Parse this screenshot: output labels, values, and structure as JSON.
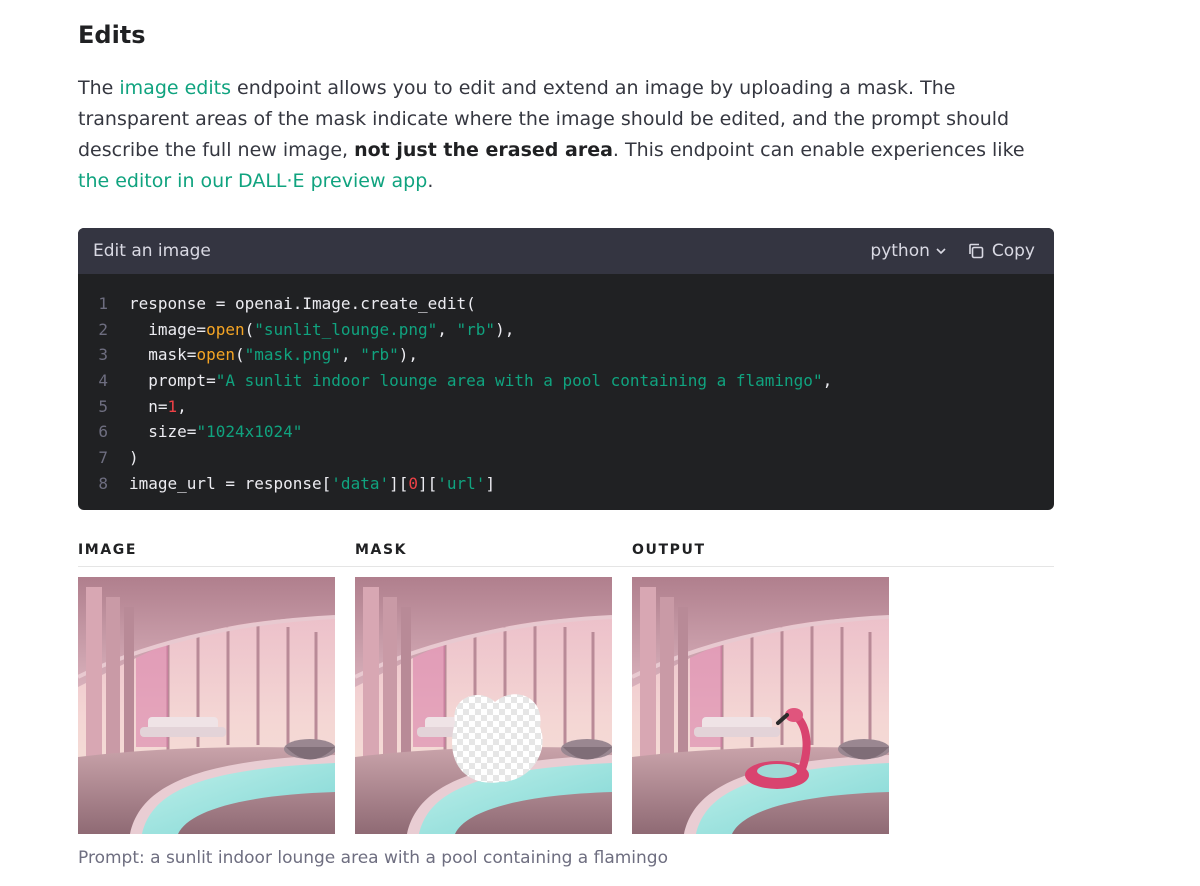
{
  "section": {
    "title": "Edits",
    "intro": {
      "p1": "The ",
      "link1": "image edits",
      "p2": " endpoint allows you to edit and extend an image by uploading a mask. The transparent areas of the mask indicate where the image should be edited, and the prompt should describe the full new image, ",
      "bold": "not just the erased area",
      "p3": ". This endpoint can enable experiences like ",
      "link2": "the editor in our DALL·E preview app",
      "p4": "."
    }
  },
  "code_card": {
    "title": "Edit an image",
    "language": "python",
    "copy_label": "Copy",
    "lines": [
      {
        "num": "1",
        "tokens": [
          {
            "t": "plain",
            "v": "response = openai.Image.create_edit("
          }
        ]
      },
      {
        "num": "2",
        "tokens": [
          {
            "t": "plain",
            "v": "  image="
          },
          {
            "t": "fn",
            "v": "open"
          },
          {
            "t": "plain",
            "v": "("
          },
          {
            "t": "str",
            "v": "\"sunlit_lounge.png\""
          },
          {
            "t": "plain",
            "v": ", "
          },
          {
            "t": "str",
            "v": "\"rb\""
          },
          {
            "t": "plain",
            "v": "),"
          }
        ]
      },
      {
        "num": "3",
        "tokens": [
          {
            "t": "plain",
            "v": "  mask="
          },
          {
            "t": "fn",
            "v": "open"
          },
          {
            "t": "plain",
            "v": "("
          },
          {
            "t": "str",
            "v": "\"mask.png\""
          },
          {
            "t": "plain",
            "v": ", "
          },
          {
            "t": "str",
            "v": "\"rb\""
          },
          {
            "t": "plain",
            "v": "),"
          }
        ]
      },
      {
        "num": "4",
        "tokens": [
          {
            "t": "plain",
            "v": "  prompt="
          },
          {
            "t": "str",
            "v": "\"A sunlit indoor lounge area with a pool containing a flamingo\""
          },
          {
            "t": "plain",
            "v": ","
          }
        ]
      },
      {
        "num": "5",
        "tokens": [
          {
            "t": "plain",
            "v": "  n="
          },
          {
            "t": "num",
            "v": "1"
          },
          {
            "t": "plain",
            "v": ","
          }
        ]
      },
      {
        "num": "6",
        "tokens": [
          {
            "t": "plain",
            "v": "  size="
          },
          {
            "t": "str",
            "v": "\"1024x1024\""
          }
        ]
      },
      {
        "num": "7",
        "tokens": [
          {
            "t": "plain",
            "v": ")"
          }
        ]
      },
      {
        "num": "8",
        "tokens": [
          {
            "t": "plain",
            "v": "image_url = response["
          },
          {
            "t": "str",
            "v": "'data'"
          },
          {
            "t": "plain",
            "v": "]["
          },
          {
            "t": "num",
            "v": "0"
          },
          {
            "t": "plain",
            "v": "]["
          },
          {
            "t": "str",
            "v": "'url'"
          },
          {
            "t": "plain",
            "v": "]"
          }
        ]
      }
    ]
  },
  "gallery": {
    "labels": [
      "IMAGE",
      "MASK",
      "OUTPUT"
    ],
    "caption": "Prompt: a sunlit indoor lounge area with a pool containing a flamingo"
  },
  "colors": {
    "link": "#10a37f",
    "code_bg": "#202123",
    "code_header_bg": "#343541",
    "string": "#10a37f",
    "function": "#f5a524",
    "number": "#ef4146"
  }
}
